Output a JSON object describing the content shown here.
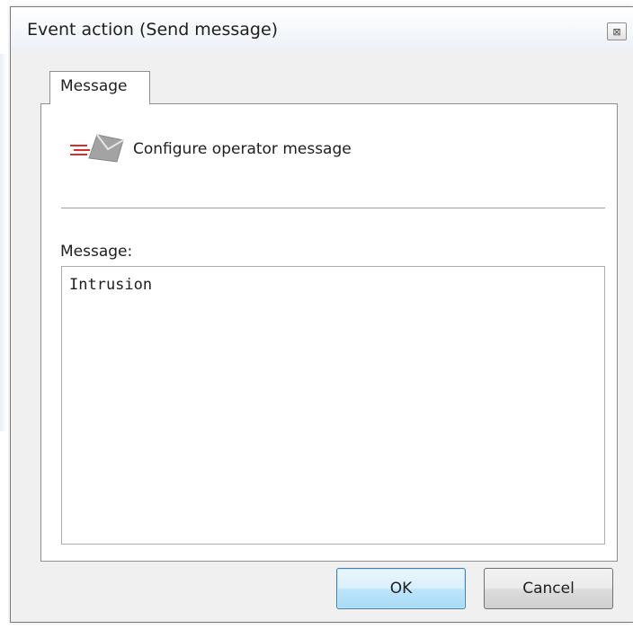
{
  "window": {
    "title": "Event action (Send message)",
    "close_symbol": "⊠"
  },
  "tabs": [
    {
      "label": "Message",
      "selected": true
    }
  ],
  "panel": {
    "icon": "envelope-send-icon",
    "heading": "Configure operator message",
    "message_label": "Message:",
    "message_value": "Intrusion"
  },
  "buttons": {
    "ok_label": "OK",
    "cancel_label": "Cancel"
  },
  "colors": {
    "ok_border": "#3c7fb1",
    "ok_fill": "#bee6fd",
    "speed_lines": "#d92c2c",
    "envelope": "#9a9a9a"
  }
}
